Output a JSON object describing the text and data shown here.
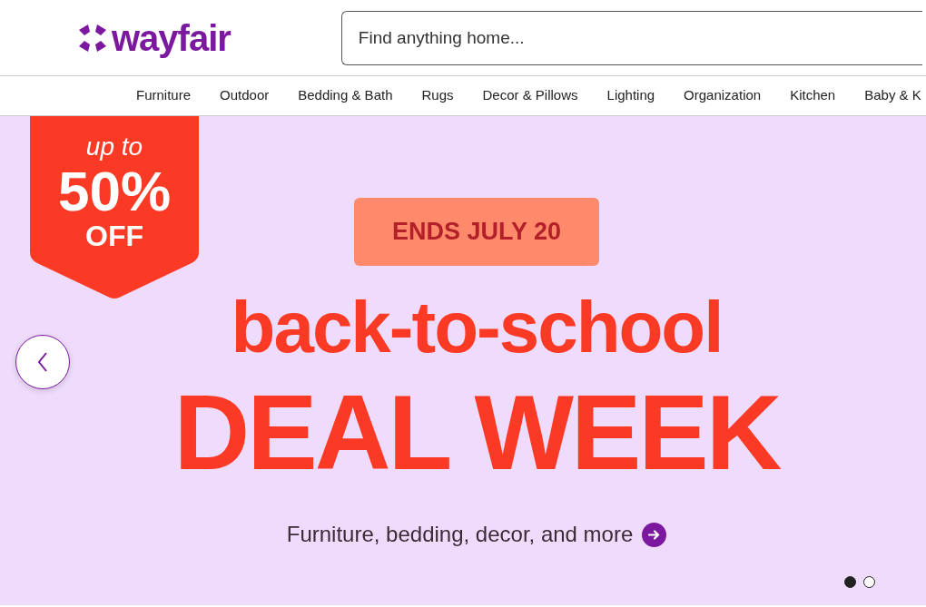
{
  "header": {
    "logo": "wayfair",
    "search": {
      "placeholder": "Find anything home..."
    }
  },
  "nav": {
    "items": [
      "Furniture",
      "Outdoor",
      "Bedding & Bath",
      "Rugs",
      "Decor & Pillows",
      "Lighting",
      "Organization",
      "Kitchen",
      "Baby & K"
    ]
  },
  "banner": {
    "badge": {
      "top": "up to",
      "amount": "50%",
      "bottom": "OFF"
    },
    "tag": "ENDS JULY 20",
    "headline": "back-to-school",
    "subheadline": "DEAL WEEK",
    "caption": "Furniture, bedding, decor, and more",
    "slides": [
      {
        "selected": true
      },
      {
        "selected": false
      }
    ]
  }
}
